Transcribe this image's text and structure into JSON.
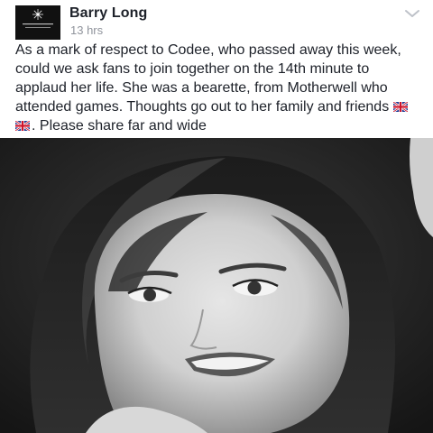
{
  "post": {
    "author": "Barry Long",
    "timestamp": "13 hrs",
    "text_before_flags": "As a mark of respect to Codee, who passed away this week, could we ask fans to join together on the 14th minute to applaud her life.  She was a bearette, from Motherwell who attended games.  Thoughts go out to her family and friends",
    "text_after_flags": ". Please share far and wide",
    "emoji": [
      "uk-flag",
      "uk-flag"
    ],
    "avatar_icon": "club-crest-icon",
    "menu_icon": "chevron-down-icon",
    "photo": "portrait-photo"
  },
  "colors": {
    "name": "#1d2129",
    "timestamp": "#90949c",
    "chevron": "#bec2c9",
    "flag_blue": "#1f3a93",
    "flag_red": "#cf142b"
  }
}
